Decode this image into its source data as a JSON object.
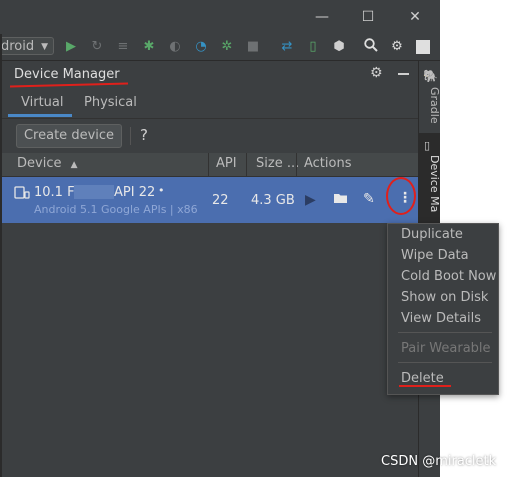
{
  "window": {
    "minimize": "—",
    "maximize": "☐",
    "close": "✕"
  },
  "toolbar": {
    "config_selector": "droid"
  },
  "panel": {
    "title": "Device Manager"
  },
  "tabs": [
    {
      "label": "Virtual",
      "active": true
    },
    {
      "label": "Physical",
      "active": false
    }
  ],
  "actions_row": {
    "create_device": "Create device",
    "help": "?"
  },
  "table": {
    "columns": [
      "Device",
      "API",
      "Size ...",
      "Actions"
    ],
    "rows": [
      {
        "name": "10.1  F",
        "name_suffix": "API 22",
        "subtitle": "Android 5.1 Google APIs | x86",
        "api": "22",
        "size": "4.3 GB"
      }
    ]
  },
  "side_tabs": {
    "gradle": "Gradle",
    "device_manager": "Device Ma"
  },
  "context_menu": {
    "items": [
      "Duplicate",
      "Wipe Data",
      "Cold Boot Now",
      "Show on Disk",
      "View Details"
    ],
    "disabled": [
      "Pair Wearable"
    ],
    "danger": "Delete"
  },
  "watermark": "CSDN @miracletk",
  "colors": {
    "selection": "#4b6eaf",
    "annotation": "#e0201b",
    "run_green": "#59a869"
  }
}
